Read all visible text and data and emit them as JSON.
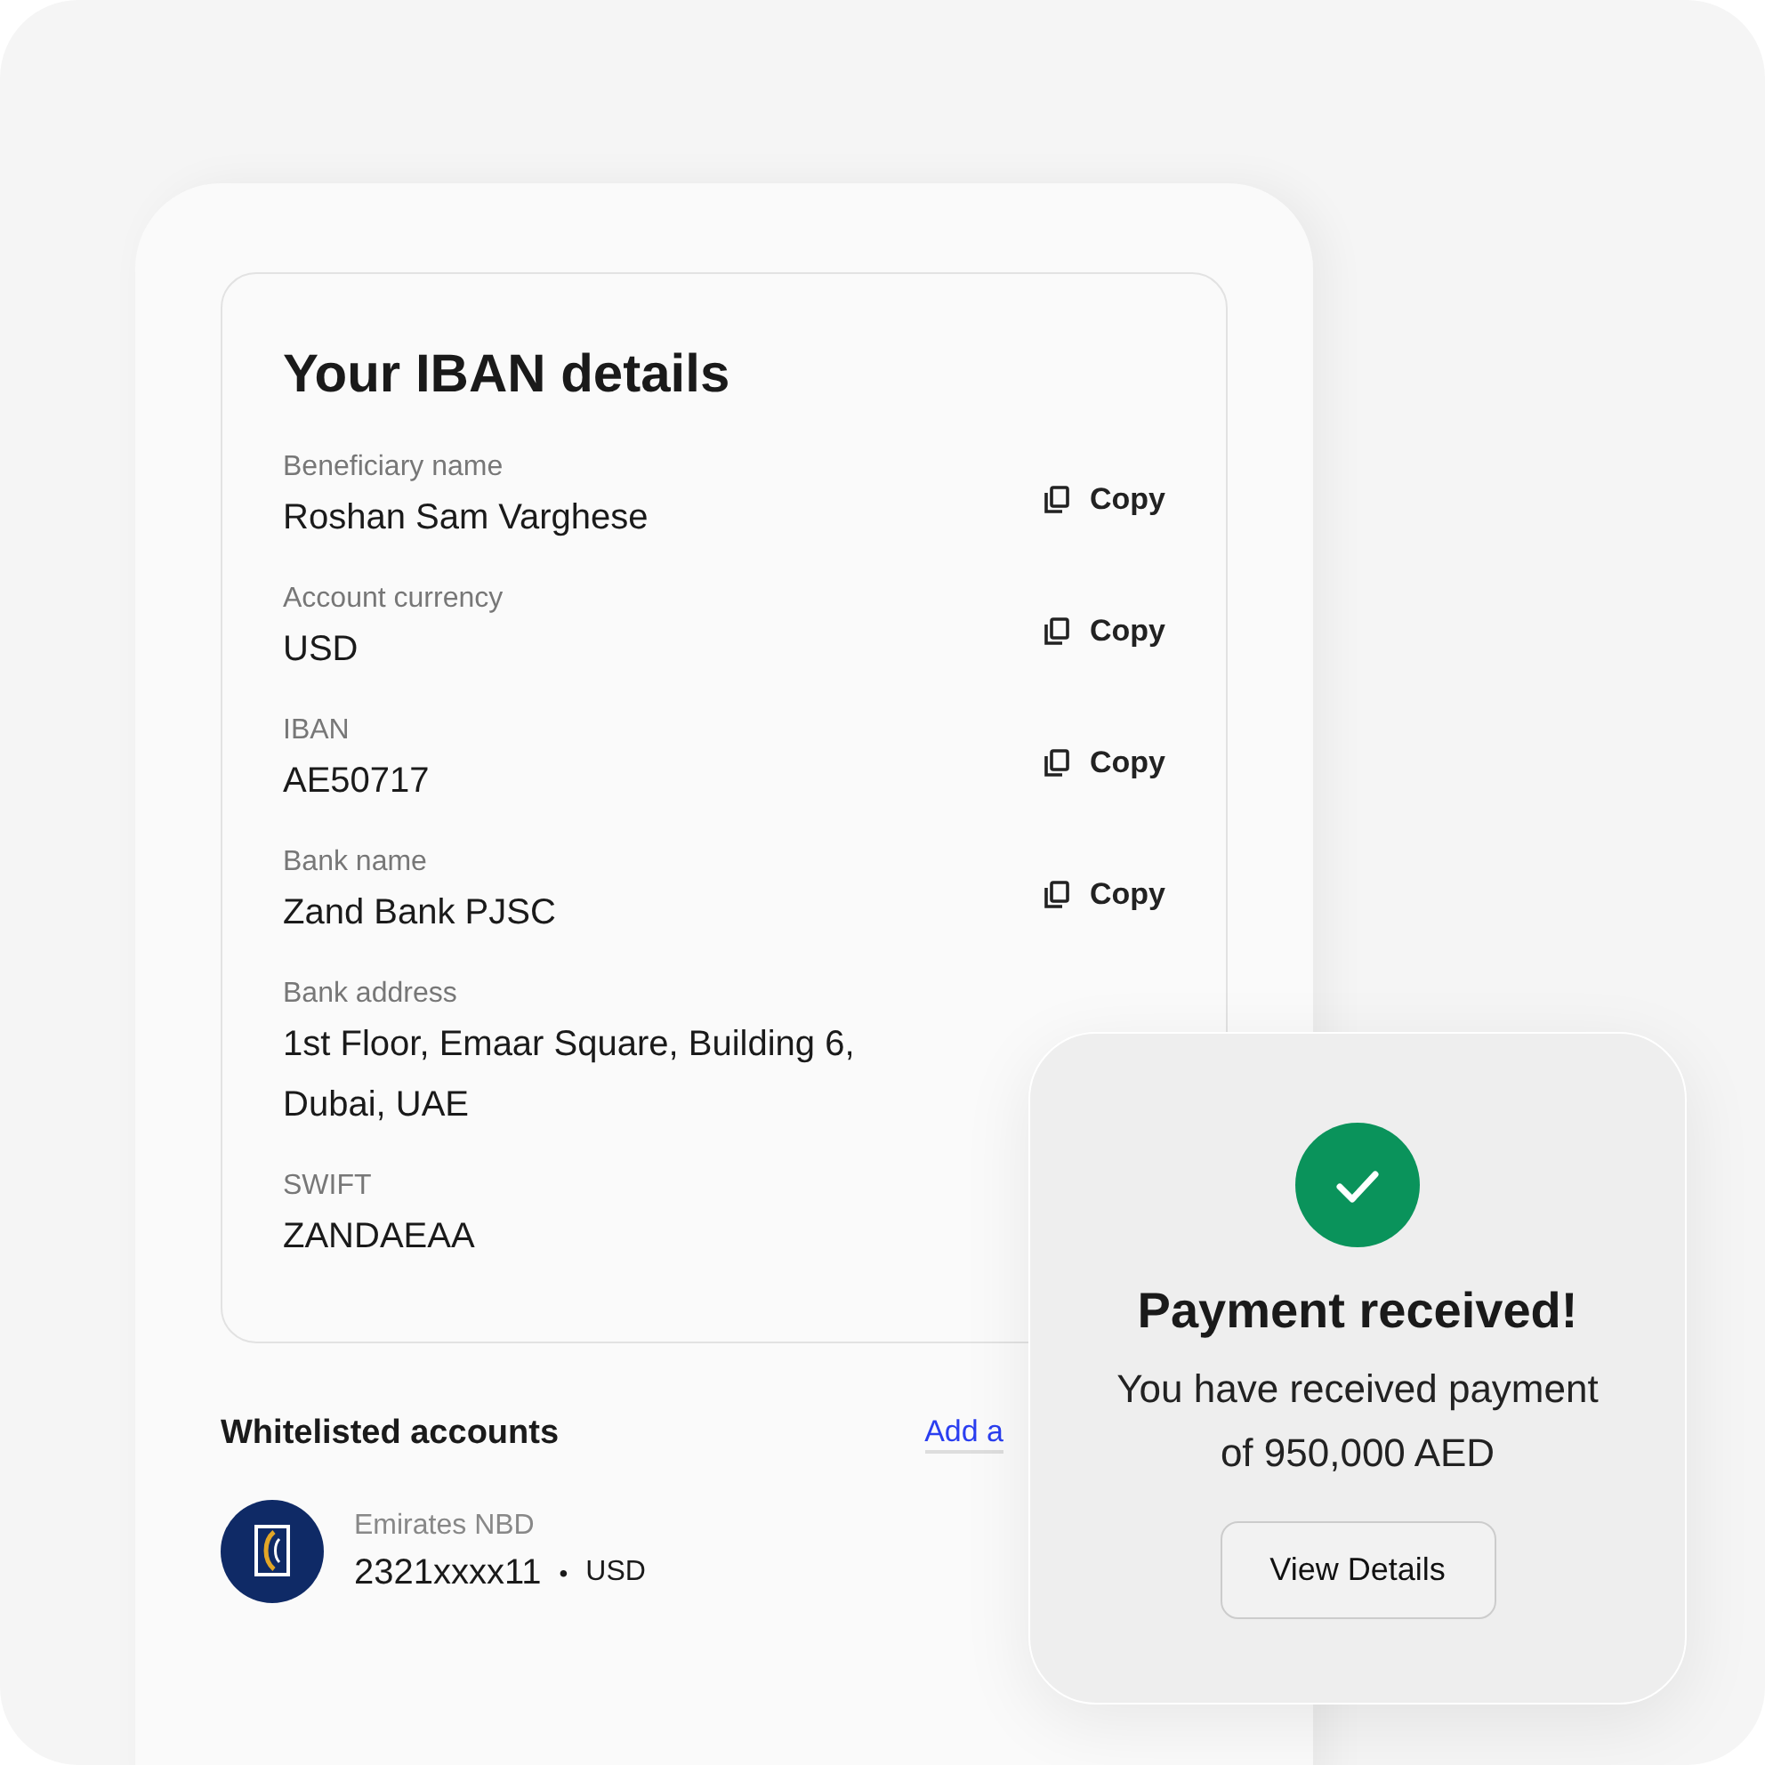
{
  "iban_card": {
    "title": "Your IBAN details",
    "fields": [
      {
        "label": "Beneficiary name",
        "value": "Roshan Sam Varghese",
        "action": "Copy"
      },
      {
        "label": "Account currency",
        "value": "USD",
        "action": "Copy"
      },
      {
        "label": "IBAN",
        "value": "AE50717",
        "action": "Copy"
      },
      {
        "label": "Bank name",
        "value": "Zand Bank PJSC",
        "action": "Copy"
      },
      {
        "label": "Bank address",
        "value": "1st Floor, Emaar Square, Building 6, Dubai, UAE"
      },
      {
        "label": "SWIFT",
        "value": "ZANDAEAA"
      }
    ]
  },
  "whitelisted": {
    "title": "Whitelisted accounts",
    "link": "Add a",
    "accounts": [
      {
        "bank": "Emirates NBD",
        "number": "2321xxxx11",
        "separator": "•",
        "currency": "USD"
      }
    ]
  },
  "toast": {
    "title": "Payment received!",
    "message": "You have received payment of 950,000 AED",
    "button": "View Details"
  }
}
